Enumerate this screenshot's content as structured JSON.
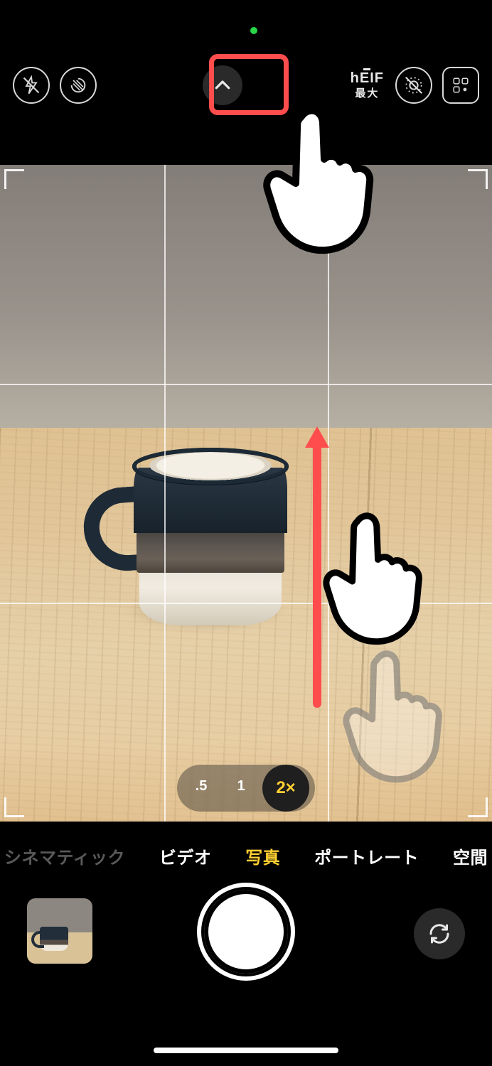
{
  "status": {
    "camera_active": true
  },
  "topbar": {
    "heif_line1": "hEIF",
    "heif_line2": "最大"
  },
  "zoom": {
    "options": [
      ".5",
      "1",
      "2×"
    ],
    "active_index": 2
  },
  "modes": {
    "items": [
      "シネマティック",
      "ビデオ",
      "写真",
      "ポートレート",
      "空間"
    ],
    "active_index": 2,
    "dim_first": true
  }
}
